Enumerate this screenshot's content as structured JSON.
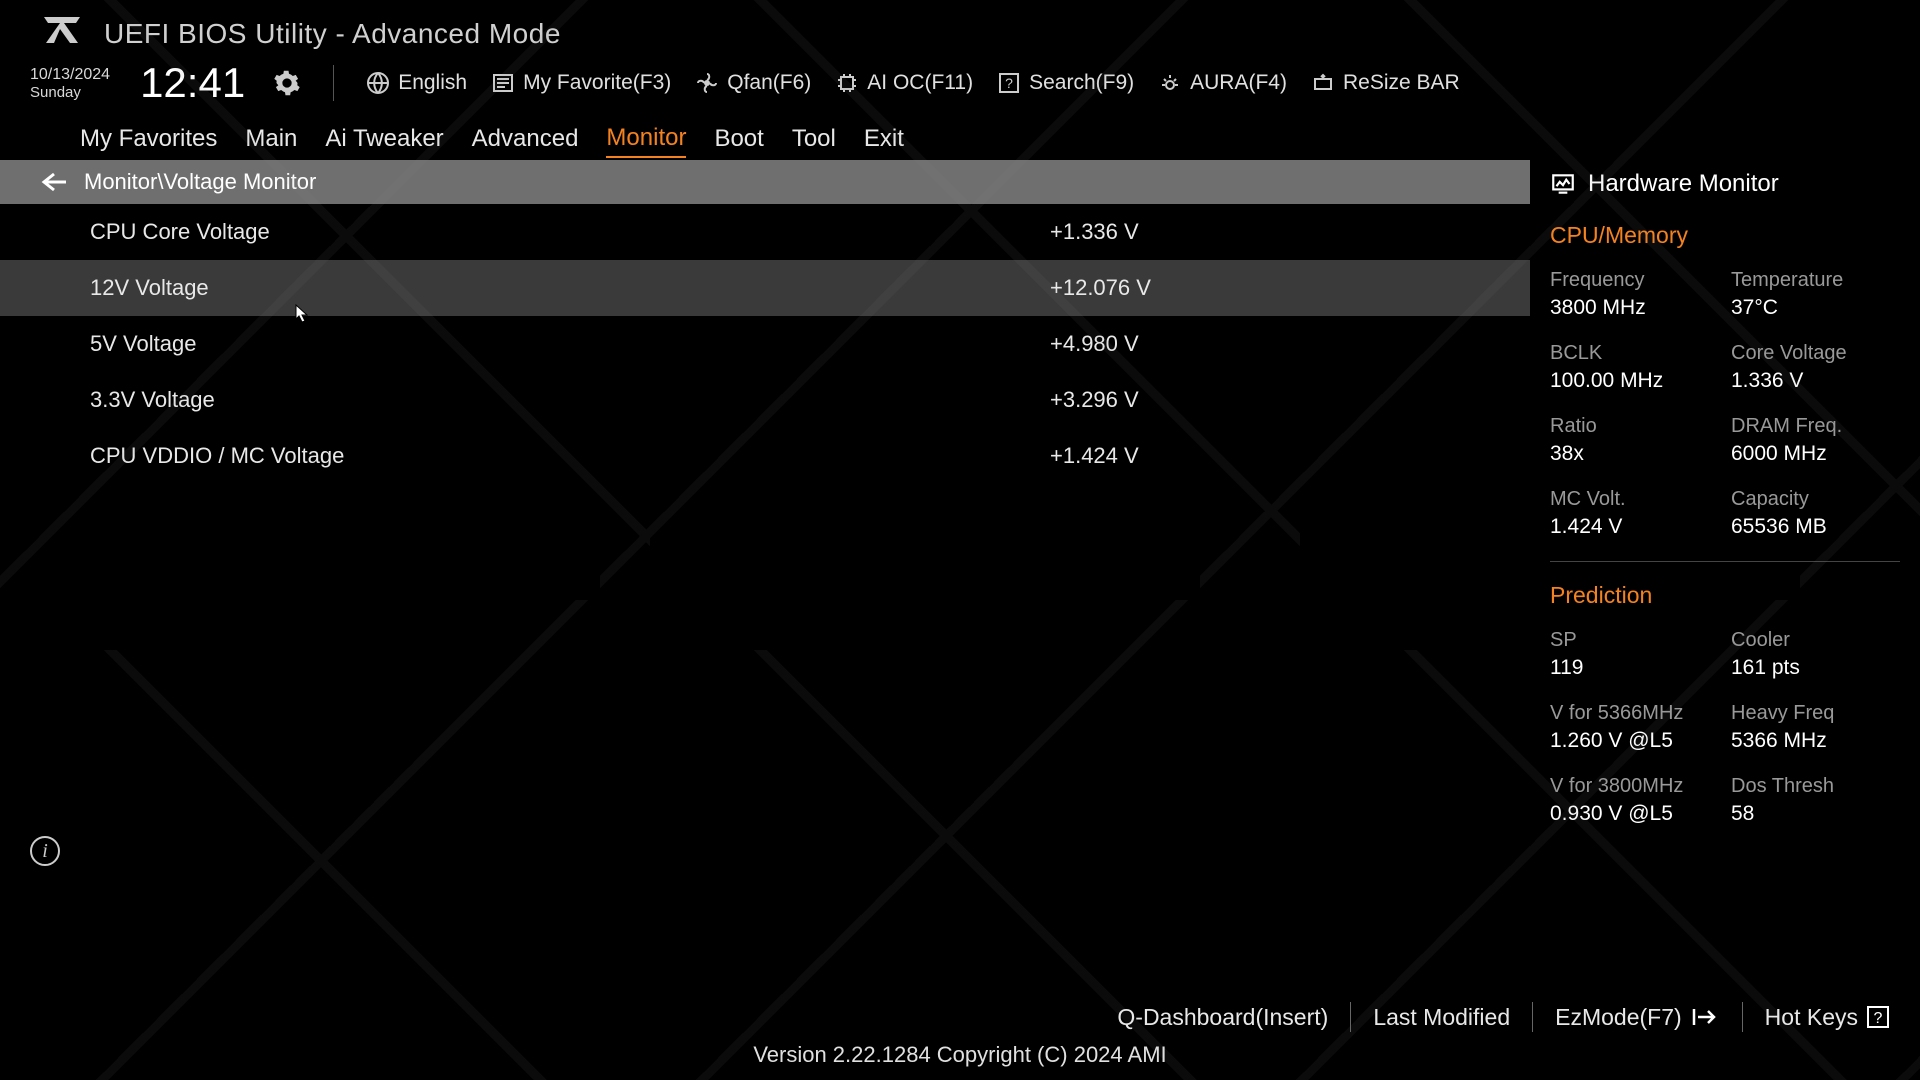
{
  "header": {
    "title": "UEFI BIOS Utility - Advanced Mode"
  },
  "datetime": {
    "date": "10/13/2024",
    "day": "Sunday",
    "time": "12:41"
  },
  "top_actions": {
    "language": "English",
    "my_favorite": "My Favorite(F3)",
    "qfan": "Qfan(F6)",
    "ai_oc": "AI OC(F11)",
    "search": "Search(F9)",
    "aura": "AURA(F4)",
    "resize_bar": "ReSize BAR"
  },
  "nav_tabs": [
    "My Favorites",
    "Main",
    "Ai Tweaker",
    "Advanced",
    "Monitor",
    "Boot",
    "Tool",
    "Exit"
  ],
  "nav_active_index": 4,
  "breadcrumb": "Monitor\\Voltage Monitor",
  "voltage_rows": [
    {
      "label": "CPU Core Voltage",
      "value": "+1.336 V"
    },
    {
      "label": "12V Voltage",
      "value": "+12.076 V"
    },
    {
      "label": "5V Voltage",
      "value": "+4.980 V"
    },
    {
      "label": "3.3V Voltage",
      "value": "+3.296 V"
    },
    {
      "label": "CPU VDDIO / MC Voltage",
      "value": "+1.424 V"
    }
  ],
  "voltage_selected_index": 1,
  "sidebar": {
    "title": "Hardware Monitor",
    "sections": [
      {
        "title": "CPU/Memory",
        "metrics": [
          {
            "label": "Frequency",
            "value": "3800 MHz"
          },
          {
            "label": "Temperature",
            "value": "37°C"
          },
          {
            "label": "BCLK",
            "value": "100.00 MHz"
          },
          {
            "label": "Core Voltage",
            "value": "1.336 V"
          },
          {
            "label": "Ratio",
            "value": "38x"
          },
          {
            "label": "DRAM Freq.",
            "value": "6000 MHz"
          },
          {
            "label": "MC Volt.",
            "value": "1.424 V"
          },
          {
            "label": "Capacity",
            "value": "65536 MB"
          }
        ]
      },
      {
        "title": "Prediction",
        "metrics": [
          {
            "label": "SP",
            "value": "119"
          },
          {
            "label": "Cooler",
            "value": "161 pts"
          },
          {
            "label_pre": "V for ",
            "label_hl": "5366MHz",
            "value": "1.260 V @L5"
          },
          {
            "label": "Heavy Freq",
            "value": "5366 MHz"
          },
          {
            "label_pre": "V for ",
            "label_hl": "3800MHz",
            "value": "0.930 V @L5"
          },
          {
            "label": "Dos Thresh",
            "value": "58"
          }
        ]
      }
    ]
  },
  "bottom_actions": {
    "q_dashboard": "Q-Dashboard(Insert)",
    "last_modified": "Last Modified",
    "ez_mode": "EzMode(F7)",
    "hot_keys": "Hot Keys"
  },
  "version": "Version 2.22.1284 Copyright (C) 2024 AMI"
}
